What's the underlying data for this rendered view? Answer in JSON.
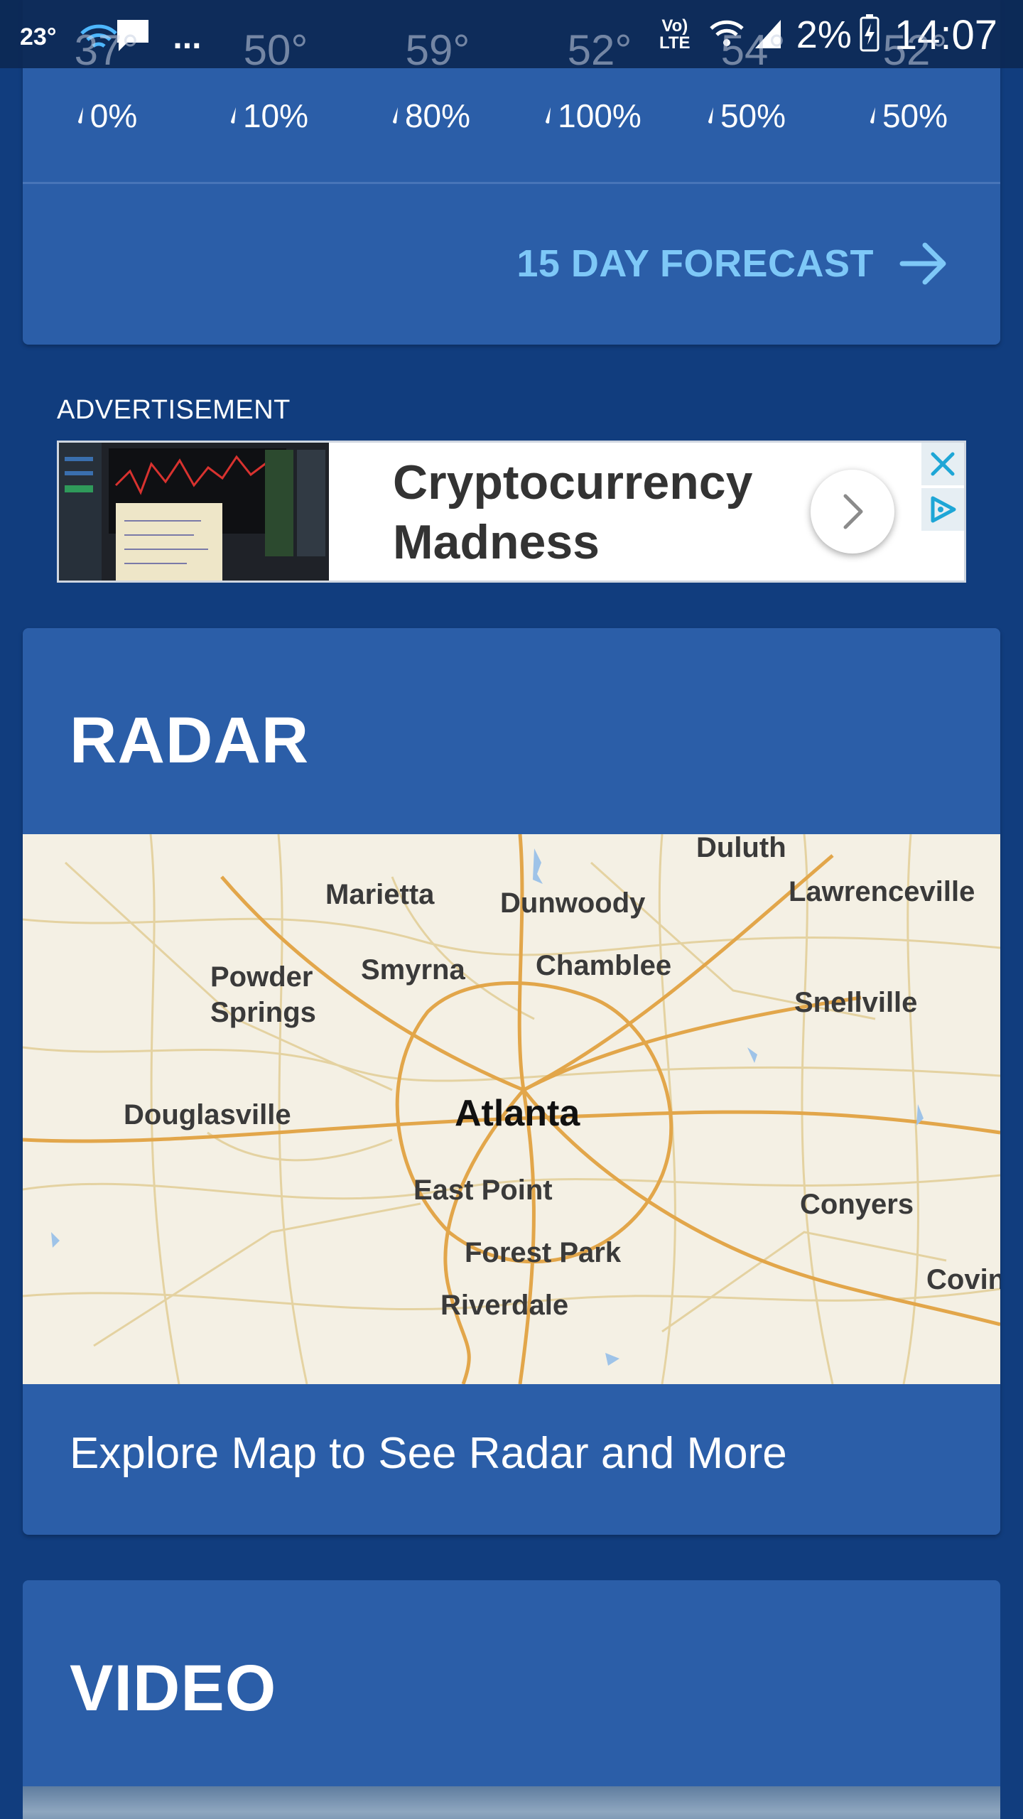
{
  "status_bar": {
    "temperature": "23°",
    "overflow": "...",
    "network": "Vo) LTE",
    "battery": "2%",
    "time": "14:07"
  },
  "forecast": {
    "ghost_temps": [
      "37°",
      "50°",
      "59°",
      "52°",
      "54°",
      "52°"
    ],
    "precip": [
      "0%",
      "10%",
      "80%",
      "100%",
      "50%",
      "50%"
    ],
    "link_label": "15 DAY FORECAST"
  },
  "ad": {
    "label": "ADVERTISEMENT",
    "headline_line1": "Cryptocurrency",
    "headline_line2": "Madness"
  },
  "radar": {
    "title": "RADAR",
    "caption": "Explore Map to See Radar and More",
    "cities": [
      "Duluth",
      "Marietta",
      "Dunwoody",
      "Lawrenceville",
      "Powder Springs",
      "Smyrna",
      "Chamblee",
      "Snellville",
      "Douglasville",
      "Atlanta",
      "East Point",
      "Conyers",
      "Forest Park",
      "Riverdale",
      "Covin"
    ]
  },
  "video": {
    "title": "VIDEO"
  },
  "colors": {
    "background": "#113d7e",
    "card": "#2b5ea8",
    "link": "#7ec8f7",
    "map_land": "#f4f0e4"
  }
}
